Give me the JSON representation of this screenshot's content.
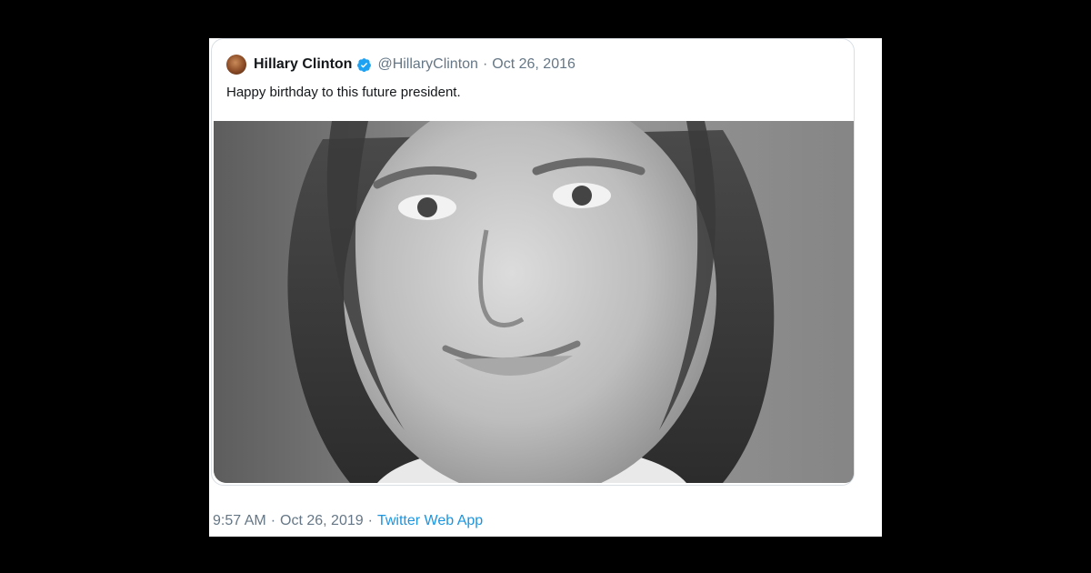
{
  "tweet": {
    "author_name": "Hillary Clinton",
    "handle": "@HillaryClinton",
    "separator": "·",
    "date": "Oct 26, 2016",
    "text": "Happy birthday to this future president.",
    "photo_description_icon": "portrait-photo"
  },
  "footer": {
    "time": "9:57 AM",
    "separator": "·",
    "date": "Oct 26, 2019",
    "separator2": "·",
    "source": "Twitter Web App"
  },
  "colors": {
    "background": "#000000",
    "card": "#ffffff",
    "name": "#14171a",
    "meta": "#657786",
    "link": "#1b95e0",
    "verified": "#1da1f2"
  }
}
